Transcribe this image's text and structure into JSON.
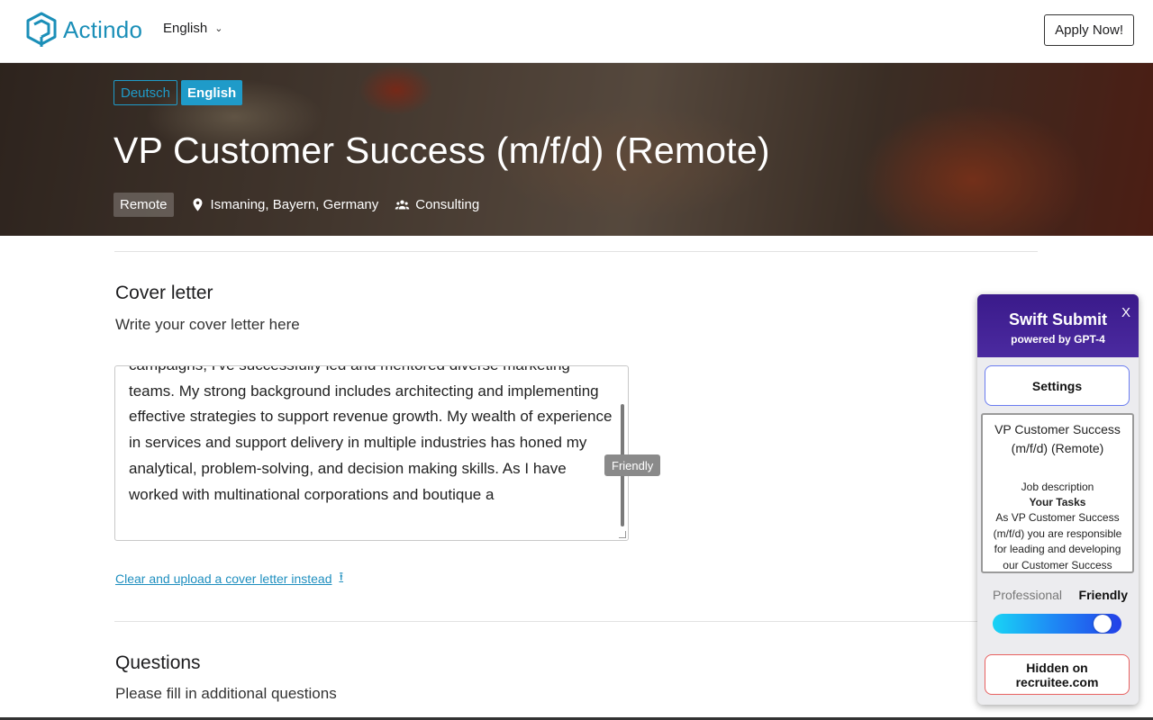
{
  "header": {
    "brand": "Actindo",
    "language": "English",
    "apply_label": "Apply Now!"
  },
  "hero": {
    "languages": [
      {
        "label": "Deutsch",
        "active": false
      },
      {
        "label": "English",
        "active": true
      }
    ],
    "title": "VP Customer Success (m/f/d) (Remote)",
    "work_type": "Remote",
    "location": "Ismaning, Bayern, Germany",
    "department": "Consulting"
  },
  "cover_letter": {
    "title": "Cover letter",
    "subtitle": "Write your cover letter here",
    "text": "campaigns, I've successfully led and mentored diverse marketing teams. My strong background includes architecting and implementing effective strategies to support revenue growth. My wealth of experience in services and support delivery in multiple industries has honed my analytical, problem-solving, and decision making skills. As I have worked with multinational corporations and boutique a",
    "tooltip": "Friendly",
    "upload_link": "Clear and upload a cover letter instead"
  },
  "questions": {
    "title": "Questions",
    "subtitle": "Please fill in additional questions"
  },
  "extension": {
    "title": "Swift Submit",
    "subtitle": "powered by GPT-4",
    "close_label": "X",
    "settings_label": "Settings",
    "job_title": "VP Customer Success (m/f/d) (Remote)",
    "job_label": "Job description",
    "job_tasks": "Your Tasks",
    "job_body": "As VP Customer Success (m/f/d) you are responsible for leading and developing our Customer Success Team. Likewise, you position Actindo",
    "tone_left": "Professional",
    "tone_right": "Friendly",
    "tone_level": 0.92,
    "hidden_line1": "Hidden on",
    "hidden_line2": "recruitee.com"
  },
  "colors": {
    "brand": "#1b8fb8",
    "accent": "#1f9bc9",
    "extension_header": "#3a1a8a"
  }
}
